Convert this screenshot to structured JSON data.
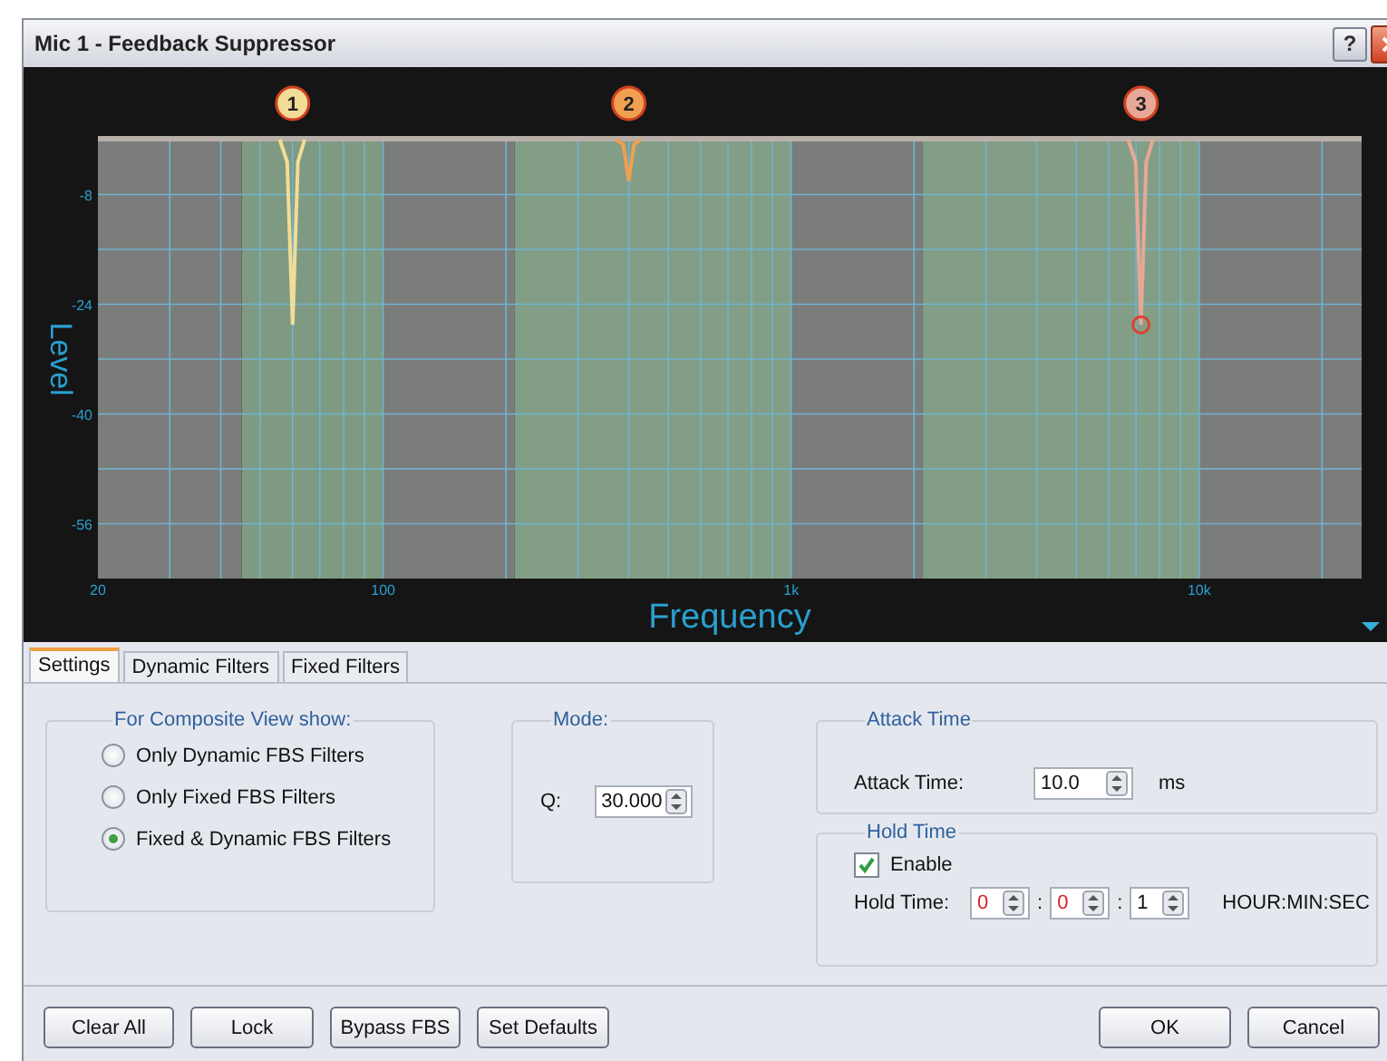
{
  "window": {
    "title": "Mic 1 - Feedback Suppressor",
    "help": "?"
  },
  "spectrum": {
    "x_axis_title": "Frequency",
    "y_axis_title": "Level",
    "x_tick_labels": [
      "20",
      "100",
      "1k",
      "10k"
    ],
    "y_tick_labels": [
      "-8",
      "-24",
      "-40",
      "-56"
    ],
    "filters": [
      {
        "label": "1",
        "color": "#f2dc96",
        "selected": false
      },
      {
        "label": "2",
        "color": "#f0a050",
        "selected": false
      },
      {
        "label": "3",
        "color": "#e8a898",
        "selected": true
      }
    ]
  },
  "tabs": [
    {
      "label": "Settings",
      "selected": true
    },
    {
      "label": "Dynamic Filters",
      "selected": false
    },
    {
      "label": "Fixed Filters",
      "selected": false
    }
  ],
  "composite_view": {
    "title": "For Composite View show:",
    "options": [
      {
        "label": "Only Dynamic FBS Filters",
        "selected": false
      },
      {
        "label": "Only Fixed FBS Filters",
        "selected": false
      },
      {
        "label": "Fixed & Dynamic FBS Filters",
        "selected": true
      }
    ]
  },
  "mode": {
    "title": "Mode:",
    "q_label": "Q:",
    "q_value": "30.000"
  },
  "attack_time": {
    "title": "Attack Time",
    "label": "Attack Time:",
    "value": "10.0",
    "unit": "ms"
  },
  "hold_time": {
    "title": "Hold Time",
    "enable": {
      "label": "Enable",
      "checked": true
    },
    "label": "Hold Time:",
    "fields": [
      {
        "value": "0",
        "highlighted": true
      },
      {
        "value": "0",
        "highlighted": true
      },
      {
        "value": "1",
        "highlighted": false
      }
    ],
    "separators": [
      ":",
      ":"
    ],
    "unit": "HOUR:MIN:SEC"
  },
  "buttons_left": [
    "Clear All",
    "Lock",
    "Bypass FBS",
    "Set Defaults"
  ],
  "buttons_right": [
    "OK",
    "Cancel"
  ]
}
